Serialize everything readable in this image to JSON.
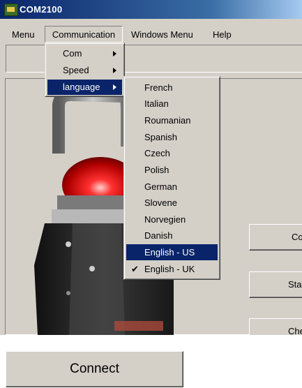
{
  "window": {
    "title": "COM2100"
  },
  "menubar": {
    "items": [
      "Menu",
      "Communication",
      "Windows Menu",
      "Help"
    ]
  },
  "comm_menu": {
    "items": [
      "Com",
      "Speed",
      "language"
    ],
    "selected": "language"
  },
  "language_menu": {
    "items": [
      "French",
      "Italian",
      "Roumanian",
      "Spanish",
      "Czech",
      "Polish",
      "German",
      "Slovene",
      "Norvegien",
      "Danish",
      "English - US",
      "English - UK"
    ],
    "highlighted": "English - US",
    "checked": "English - UK"
  },
  "side_buttons": {
    "connect_partial": "Co",
    "start_partial": "Sta",
    "check_partial": "Chec"
  },
  "connect_button": {
    "label": "Connect"
  },
  "colors": {
    "title_bar": "#0a246a",
    "highlight": "#0a246a",
    "face": "#d4d0c8"
  },
  "icons": {
    "app": "app-icon",
    "submenu": "submenu-arrow-icon",
    "check": "checkmark-icon"
  }
}
